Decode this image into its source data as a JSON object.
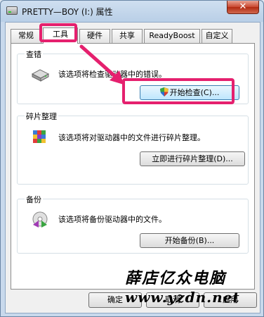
{
  "window": {
    "title": "PRETTY—BOY (I:) 属性",
    "close_label": "✕"
  },
  "tabs": [
    {
      "label": "常规"
    },
    {
      "label": "工具"
    },
    {
      "label": "硬件"
    },
    {
      "label": "共享"
    },
    {
      "label": "ReadyBoost"
    },
    {
      "label": "自定义"
    }
  ],
  "active_tab": "工具",
  "groups": {
    "error_check": {
      "label": "查错",
      "description": "该选项将检查驱动器中的错误。",
      "button": "开始检查(C)..."
    },
    "defrag": {
      "label": "碎片整理",
      "description": "该选项将对驱动器中的文件进行碎片整理。",
      "button": "立即进行碎片整理(D)..."
    },
    "backup": {
      "label": "备份",
      "description": "该选项将备份驱动器中的文件。",
      "button": "开始备份(B)..."
    }
  },
  "footer": {
    "ok": "确定",
    "cancel": "取消",
    "apply": "应用"
  },
  "watermark": {
    "line1": "薛店亿众电脑",
    "line2": "www.yzdn.net"
  },
  "colors": {
    "highlight": "#e5206e",
    "window_frame": "#b9cfe7"
  }
}
